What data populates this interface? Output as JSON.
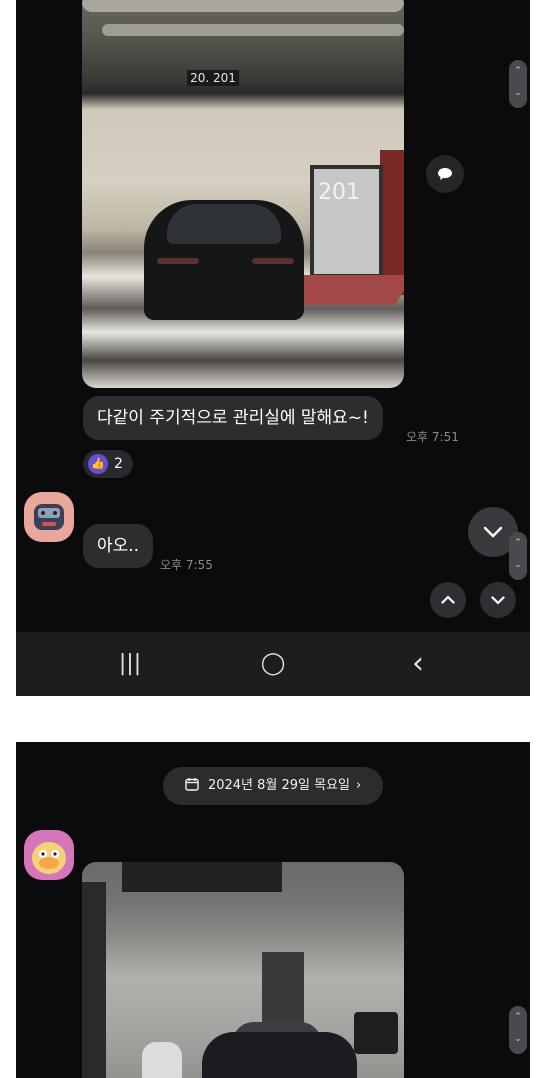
{
  "top_screen": {
    "ceiling_sign": "20. 201",
    "door_number": "201",
    "messages": [
      {
        "text": "다같이 주기적으로 관리실에 말해요~!",
        "time": "오후 7:51"
      },
      {
        "text": "아오..",
        "time": "오후 7:55"
      }
    ],
    "reaction": {
      "icon": "thumbs-up-icon",
      "count": "2"
    },
    "buttons": {
      "comment": "speech-bubble-icon",
      "scroll_down_large": "chevron-down-icon",
      "scroll_up": "chevron-up-icon",
      "scroll_down": "chevron-down-icon"
    }
  },
  "navbar": {
    "recent": "|||",
    "home": "◯",
    "back": "‹"
  },
  "bottom_screen": {
    "date_label": "2024년 8월 29일 목요일"
  },
  "colors": {
    "chat_background": "#0b0b0d",
    "bubble": "#2d2d30",
    "reaction_accent": "#6a4cd9"
  }
}
